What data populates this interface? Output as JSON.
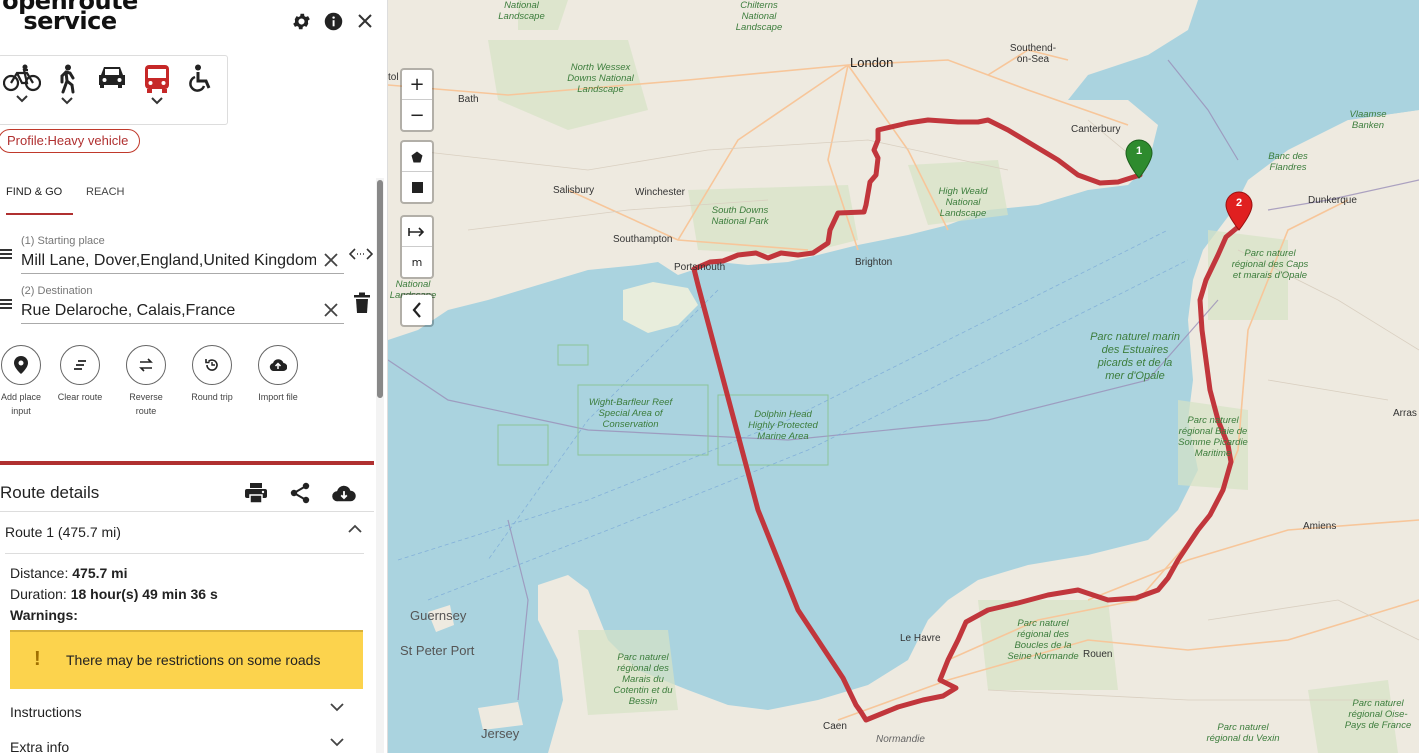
{
  "app": {
    "logo_line1": "openroute",
    "logo_line2": "service"
  },
  "header_icons": [
    "gear-icon",
    "info-icon",
    "close-icon"
  ],
  "profiles": [
    {
      "name": "cycling",
      "icon": "bicycle-icon",
      "has_dropdown": true
    },
    {
      "name": "walking",
      "icon": "pedestrian-icon",
      "has_dropdown": true
    },
    {
      "name": "car",
      "icon": "car-icon",
      "has_dropdown": false
    },
    {
      "name": "heavy-vehicle",
      "icon": "bus-icon",
      "has_dropdown": true,
      "active": true
    },
    {
      "name": "wheelchair",
      "icon": "wheelchair-icon",
      "has_dropdown": false
    }
  ],
  "profile_chip": "Profile:Heavy vehicle",
  "tabs": [
    {
      "label": "FIND & GO",
      "active": true
    },
    {
      "label": "REACH",
      "active": false
    }
  ],
  "places": [
    {
      "label": "(1) Starting place",
      "value": "Mill Lane, Dover,England,United Kingdom"
    },
    {
      "label": "(2) Destination",
      "value": "Rue Delaroche, Calais,France"
    }
  ],
  "actions": [
    {
      "label_line1": "Add place",
      "label_line2": "input",
      "icon": "add-place-icon"
    },
    {
      "label_line1": "Clear route",
      "label_line2": "",
      "icon": "clear-route-icon"
    },
    {
      "label_line1": "Reverse",
      "label_line2": "route",
      "icon": "reverse-route-icon"
    },
    {
      "label_line1": "Round trip",
      "label_line2": "",
      "icon": "round-trip-icon"
    },
    {
      "label_line1": "Import file",
      "label_line2": "",
      "icon": "import-file-icon"
    }
  ],
  "route_details": {
    "title": "Route details",
    "route_label": "Route 1 (475.7 mi)",
    "distance_label": "Distance:",
    "distance_value": "475.7 mi",
    "duration_label": "Duration:",
    "duration_value": "18 hour(s) 49 min 36 s",
    "warnings_label": "Warnings:",
    "warning_text": "There may be restrictions on some roads",
    "instructions_label": "Instructions",
    "extra_info_label": "Extra info"
  },
  "map": {
    "zoom_in": "+",
    "zoom_out": "−",
    "measure_unit": "m",
    "markers": [
      "1",
      "2"
    ],
    "route_color": "#c1363c",
    "water_color": "#aad3df",
    "land_color": "#f2efe9",
    "labels": {
      "london": "London",
      "canterbury": "Canterbury",
      "southend": "Southend-on-Sea",
      "bath": "Bath",
      "bristol": "tol",
      "salisbury": "Salisbury",
      "winchester": "Winchester",
      "southampton": "Southampton",
      "portsmouth": "Portsmouth",
      "brighton": "Brighton",
      "dunkerque": "Dunkerque",
      "le_havre": "Le Havre",
      "rouen": "Rouen",
      "caen": "Caen",
      "amiens": "Amiens",
      "arras": "Arras",
      "guernsey": "Guernsey",
      "st_peter_port": "St Peter Port",
      "jersey": "Jersey",
      "normandie": "Normandie",
      "north_wessex": "North Wessex Downs National Landscape",
      "chilterns": "Chilterns National Landscape",
      "south_downs": "South Downs National Park",
      "high_weald": "High Weald National Landscape",
      "wight_barfleur": "Wight-Barfleur Reef Special Area of Conservation",
      "dolphin": "Dolphin Head Highly Protected Marine Area",
      "vlaamse_banken": "Vlaamse Banken",
      "banc_des_flandres": "Banc des Flandres",
      "parc_caps": "Parc naturel régional des Caps et marais d'Opale",
      "parc_marin": "Parc naturel marin des Estuaires picards et de la mer d'Opale",
      "parc_baie_somme": "Parc naturel régional Baie de Somme Picardie Maritime",
      "parc_seine": "Parc naturel régional des Boucles de la Seine Normande",
      "parc_cotentin": "Parc naturel régional des Marais du Cotentin et du Bessin",
      "parc_oise": "Parc naturel régional Oise-Pays de France",
      "parc_vexin": "Parc naturel régional du Vexin",
      "national_landscape": "National Landscape",
      "national_landscape_2": "National Landscape"
    }
  }
}
